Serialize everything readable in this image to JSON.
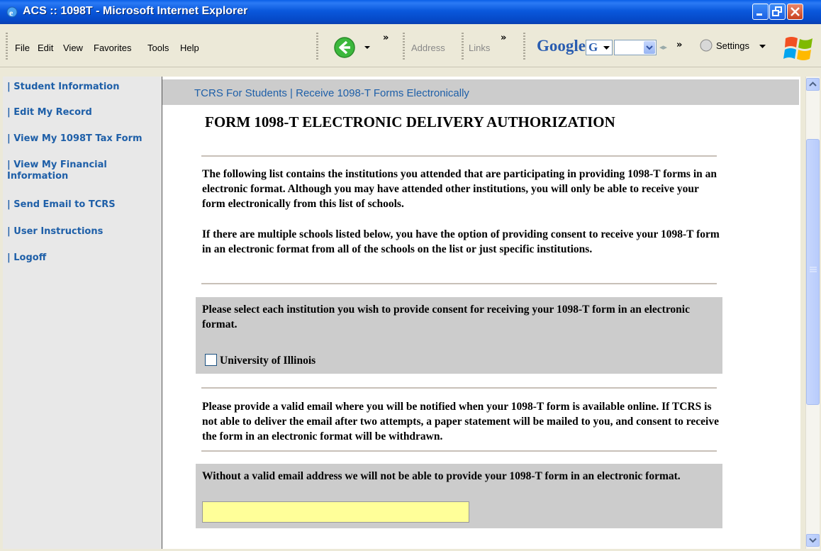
{
  "window": {
    "title": "ACS :: 1098T - Microsoft Internet Explorer"
  },
  "menu": {
    "file": "File",
    "edit": "Edit",
    "view": "View",
    "favorites": "Favorites",
    "tools": "Tools",
    "help": "Help"
  },
  "toolbar": {
    "address_label": "Address",
    "links_label": "Links",
    "more_chevron": "»",
    "google_label": "Google",
    "google_box_text": "G",
    "settings_label": "Settings"
  },
  "sidebar": {
    "items": [
      {
        "label": "| Student Information"
      },
      {
        "label": "| Edit My Record"
      },
      {
        "label": "| View My 1098T Tax Form"
      },
      {
        "label": "| View My Financial Information"
      },
      {
        "label": "| Send Email to TCRS"
      },
      {
        "label": "| User Instructions"
      },
      {
        "label": "| Logoff"
      }
    ]
  },
  "content": {
    "breadcrumb": "TCRS For Students | Receive 1098-T Forms Electronically",
    "page_title": "FORM 1098-T ELECTRONIC DELIVERY AUTHORIZATION",
    "intro_paragraph": "The following list contains the institutions you attended that are participating in providing 1098-T forms in an electronic format. Although you may have attended other institutions, you will only be able to receive your form electronically from this list of schools.",
    "multiple_schools_paragraph": "If there are multiple schools listed below, you have the option of providing consent to receive your 1098-T form in an electronic format from all of the schools on the list or just specific institutions.",
    "select_instruction": "Please select each institution you wish to provide consent for receiving your 1098-T form in an electronic format.",
    "institution_label": "University of Illinois",
    "email_paragraph": "Please provide a valid email where you will be notified when your 1098-T form is available online. If TCRS is not able to deliver the email after two attempts, a paper statement will be mailed to you, and consent to receive the form in an electronic format will be withdrawn.",
    "email_warning": "Without a valid email address we will not be able to provide your 1098-T form in an electronic format.",
    "email_value": ""
  },
  "colors": {
    "titlebar": "#0a58dc",
    "link": "#1e5fa8",
    "panel_gray": "#cccccc",
    "email_field_bg": "#ffff99"
  }
}
